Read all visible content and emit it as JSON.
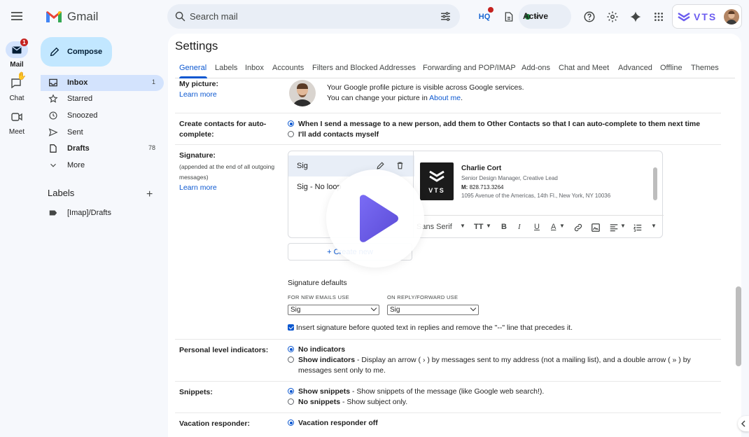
{
  "app": {
    "name": "Gmail"
  },
  "search": {
    "placeholder": "Search mail"
  },
  "status": {
    "label": "Active"
  },
  "brand": {
    "vts": "VTS",
    "accent": "#0b57d0",
    "compose_bg": "#c2e7ff"
  },
  "rail": {
    "items": [
      {
        "label": "Mail",
        "badge": "1"
      },
      {
        "label": "Chat"
      },
      {
        "label": "Meet"
      }
    ]
  },
  "nav": {
    "compose": "Compose",
    "items": [
      {
        "label": "Inbox",
        "count": "1"
      },
      {
        "label": "Starred"
      },
      {
        "label": "Snoozed"
      },
      {
        "label": "Sent"
      },
      {
        "label": "Drafts",
        "count": "78"
      },
      {
        "label": "More"
      }
    ],
    "labels_heading": "Labels",
    "labels_plus": "+",
    "labels": [
      {
        "label": "[Imap]/Drafts"
      }
    ]
  },
  "settings": {
    "title": "Settings",
    "tabs": [
      "General",
      "Labels",
      "Inbox",
      "Accounts",
      "Filters and Blocked Addresses",
      "Forwarding and POP/IMAP",
      "Add-ons",
      "Chat and Meet",
      "Advanced",
      "Offline",
      "Themes"
    ],
    "my_picture": {
      "label": "My picture:",
      "learn_more": "Learn more",
      "line1": "Your Google profile picture is visible across Google services.",
      "line2": "You can change your picture in",
      "about_me": "About me",
      "period": "."
    },
    "create_contacts": {
      "label1": "Create contacts for auto-",
      "label2": "complete:",
      "opt1": "When I send a message to a new person, add them to Other Contacts so that I can auto-complete to them next time",
      "opt2": "I'll add contacts myself"
    },
    "signature": {
      "label": "Signature:",
      "sub1": "(appended at the end of all outgoing",
      "sub2": "messages)",
      "learn_more": "Learn more",
      "list": [
        "Sig",
        "Sig - No loop"
      ],
      "create_new": "+  Create new",
      "card": {
        "logo_text": "VTS",
        "name": "Charlie Cort",
        "title": "Senior Design Manager, Creative Lead",
        "phone_label": "M:",
        "phone": "828.713.3264",
        "address": "1095 Avenue of the Americas, 14th Fl., New York, NY 10036"
      },
      "toolbar_font": "Sans Serif",
      "defaults_heading": "Signature defaults",
      "new_caption": "FOR NEW EMAILS USE",
      "reply_caption": "ON REPLY/FORWARD USE",
      "new_value": "Sig",
      "reply_value": "Sig",
      "insert_text": "Insert signature before quoted text in replies and remove the \"--\" line that precedes it."
    },
    "personal_level": {
      "label": "Personal level indicators:",
      "opt1": "No indicators",
      "opt2_bold": "Show indicators",
      "opt2_rest": " - Display an arrow ( › ) by messages sent to my address (not a mailing list), and a double arrow ( » ) by",
      "opt2_rest2": "messages sent only to me."
    },
    "snippets": {
      "label": "Snippets:",
      "opt1_bold": "Show snippets",
      "opt1_rest": " - Show snippets of the message (like Google web search!).",
      "opt2_bold": "No snippets",
      "opt2_rest": " - Show subject only."
    },
    "vacation": {
      "label": "Vacation responder:",
      "opt1": "Vacation responder off"
    }
  }
}
